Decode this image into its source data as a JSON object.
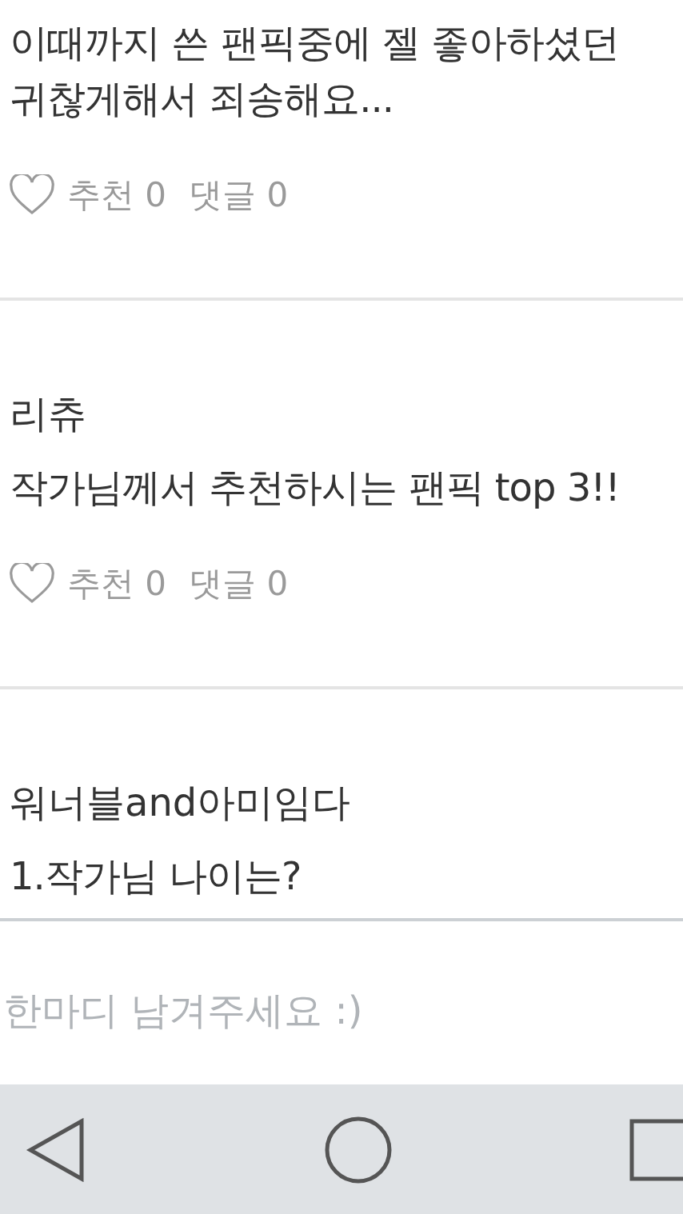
{
  "posts": [
    {
      "body": [
        "이때까지 쓴 팬픽중에 젤 좋아하셨던",
        "귀찮게해서 죄송해요..."
      ],
      "likes": "추천 0",
      "comments": "댓글 0"
    },
    {
      "author": "리츄",
      "body": [
        "작가님께서 추천하시는 팬픽 top 3!!"
      ],
      "likes": "추천 0",
      "comments": "댓글 0"
    },
    {
      "author": "워너블and아미임다",
      "body": [
        "1.작가님 나이는?"
      ]
    }
  ],
  "comment_input": {
    "placeholder": "한마디 남겨주세요 :)"
  }
}
